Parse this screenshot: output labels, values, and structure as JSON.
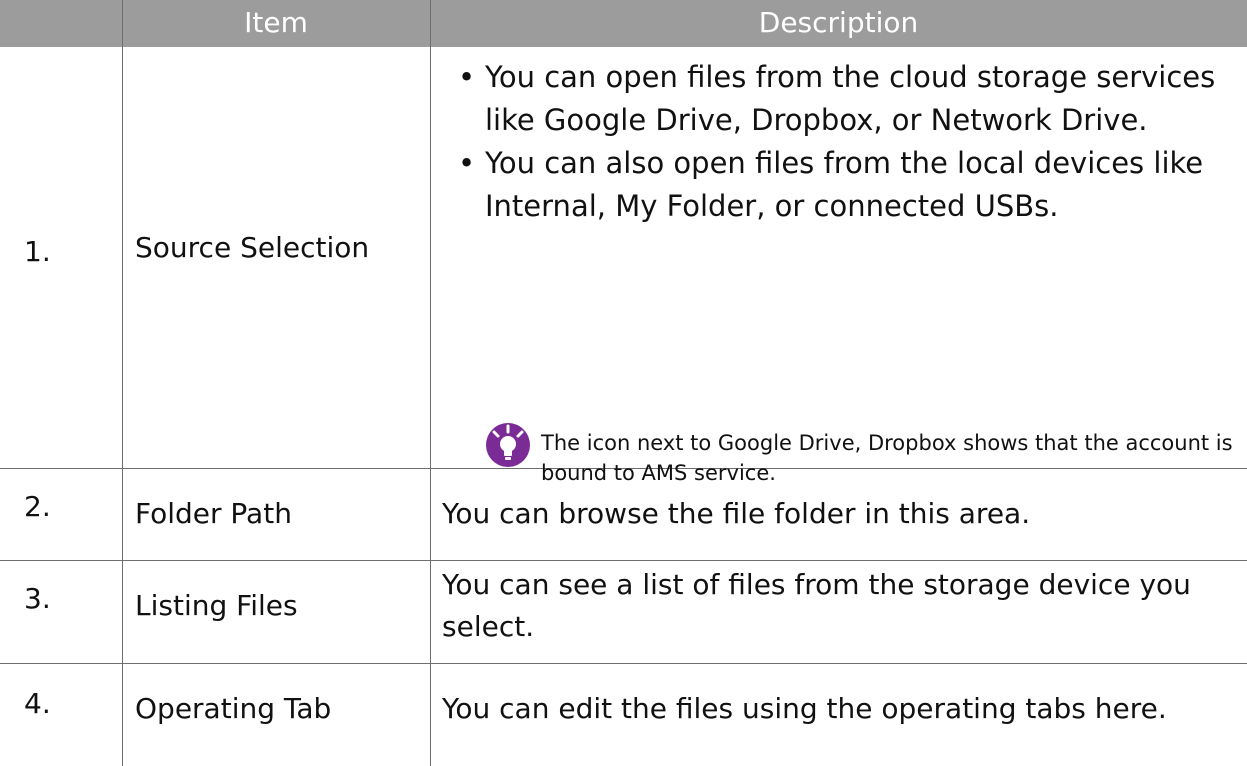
{
  "table": {
    "headers": {
      "number": "",
      "item": "Item",
      "description": "Description"
    },
    "rows": [
      {
        "number": "1.",
        "item": "Source Selection",
        "bullets": [
          "You can open files from the cloud storage services like Google Drive, Dropbox, or Network Drive.",
          "You can also open files from the local devices like Internal, My Folder, or connected USBs."
        ],
        "note": {
          "icon": "lightbulb-icon",
          "icon_color": "#7b2b96",
          "text": "The icon next to Google Drive, Dropbox shows that the account is bound to AMS service."
        }
      },
      {
        "number": "2.",
        "item": "Folder Path",
        "description": "You can browse the file folder in this area."
      },
      {
        "number": "3.",
        "item": "Listing Files",
        "description": "You can see a list of files from the storage device you select."
      },
      {
        "number": "4.",
        "item": "Operating Tab",
        "description": "You can edit the files using the operating tabs here."
      }
    ]
  },
  "colors": {
    "header_background": "#9c9c9c",
    "header_text": "#ffffff",
    "rule": "#6e6e6e"
  }
}
